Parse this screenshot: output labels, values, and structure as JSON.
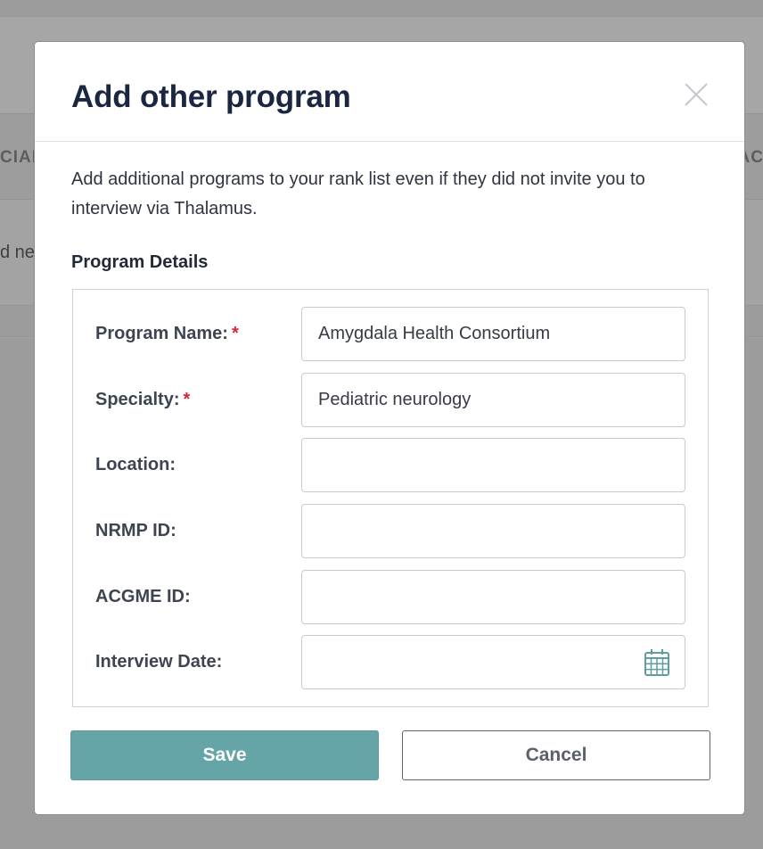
{
  "background": {
    "table_header_left": "CIAL",
    "table_header_right": "AC",
    "row_text": "d ne"
  },
  "modal": {
    "title": "Add other program",
    "description": "Add additional programs to your rank list even if they did not invite you to interview via Thalamus.",
    "section_label": "Program Details",
    "required_marker": "*",
    "fields": [
      {
        "label": "Program Name:",
        "value": "Amygdala Health Consortium",
        "required": true
      },
      {
        "label": "Specialty:",
        "value": "Pediatric neurology",
        "required": true
      },
      {
        "label": "Location:",
        "value": "",
        "required": false
      },
      {
        "label": "NRMP ID:",
        "value": "",
        "required": false
      },
      {
        "label": "ACGME ID:",
        "value": "",
        "required": false
      },
      {
        "label": "Interview Date:",
        "value": "",
        "required": false,
        "icon": "calendar-icon"
      }
    ],
    "save_label": "Save",
    "cancel_label": "Cancel",
    "close_icon": "close-icon"
  },
  "colors": {
    "accent": "#65a5a7",
    "title": "#1b2740",
    "required": "#d3283a",
    "overlay": "#a3a3a3"
  }
}
